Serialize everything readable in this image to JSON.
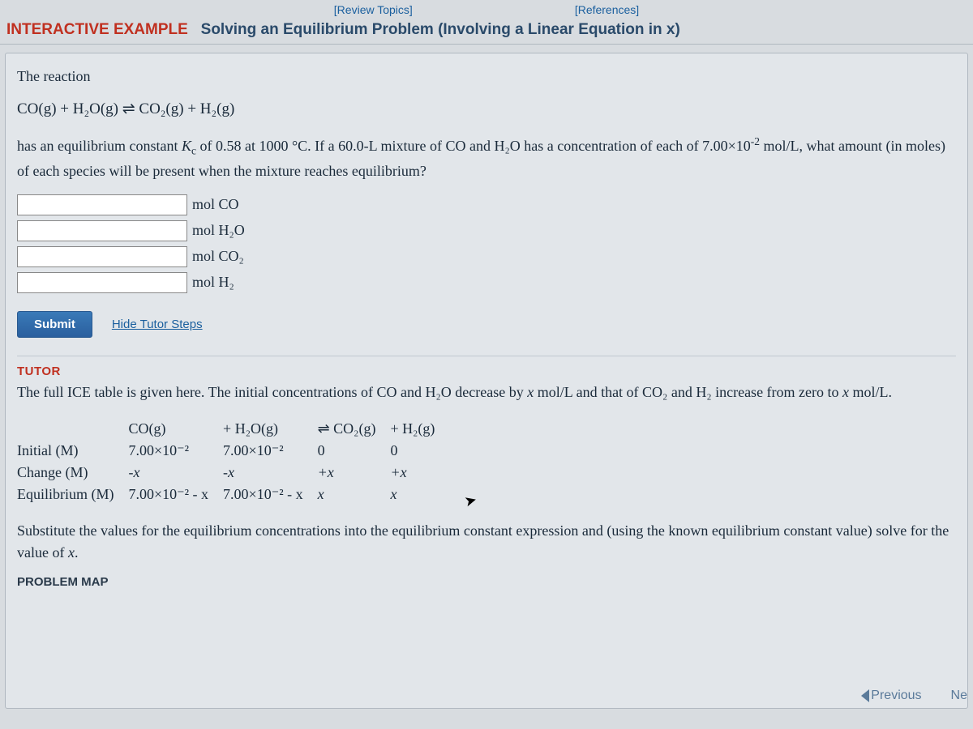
{
  "topLinks": {
    "review": "[Review Topics]",
    "references": "[References]"
  },
  "title": {
    "prefix": "INTERACTIVE EXAMPLE",
    "main": "Solving an Equilibrium Problem (Involving a Linear Equation in x)"
  },
  "problem": {
    "intro": "The reaction",
    "equation": "CO(g) + H₂O(g) ⇌ CO₂(g) + H₂(g)",
    "body_a": "has an equilibrium constant ",
    "kc": "K",
    "kc_sub": "c",
    "body_b": " of 0.58 at 1000 °C. If a 60.0-L mixture of CO and H₂O has a concentration of each of 7.00×10",
    "exp": "-2",
    "body_c": " mol/L, what amount (in moles) of each species will be present when the mixture reaches equilibrium?"
  },
  "inputs": [
    {
      "value": "",
      "label": "mol CO"
    },
    {
      "value": "",
      "label": "mol H₂O"
    },
    {
      "value": "",
      "label": "mol CO₂"
    },
    {
      "value": "",
      "label": "mol H₂"
    }
  ],
  "actions": {
    "submit": "Submit",
    "hide": "Hide Tutor Steps"
  },
  "tutor": {
    "header": "TUTOR",
    "text_a": "The full ICE table is given here. The initial concentrations of CO and H₂O decrease by ",
    "x1": "x",
    "text_b": " mol/L and that of CO₂ and H₂ increase from zero to ",
    "x2": "x",
    "text_c": " mol/L.",
    "substitute": "Substitute the values for the equilibrium concentrations into the equilibrium constant expression and (using the known equilibrium constant value) solve for the value of ",
    "x3": "x",
    "period": "."
  },
  "ice": {
    "rowLabels": [
      "Initial (M)",
      "Change (M)",
      "Equilibrium (M)"
    ],
    "header": {
      "c1": "CO(g)",
      "c2": "+ H₂O(g)",
      "c3": "⇌ CO₂(g)",
      "c4": "+ H₂(g)"
    },
    "r1": {
      "c1": "7.00×10⁻²",
      "c2": "7.00×10⁻²",
      "c3": "0",
      "c4": "0"
    },
    "r2": {
      "c1": "-x",
      "c2": "-x",
      "c3": "+x",
      "c4": "+x"
    },
    "r3": {
      "c1": "7.00×10⁻² - x",
      "c2": "7.00×10⁻² - x",
      "c3": "x",
      "c4": "x"
    }
  },
  "problemMap": "PROBLEM MAP",
  "nav": {
    "previous": "Previous",
    "next": "Ne"
  },
  "chart_data": {
    "type": "table",
    "title": "ICE table for CO(g) + H2O(g) ⇌ CO2(g) + H2(g)",
    "columns": [
      "CO(g)",
      "H2O(g)",
      "CO2(g)",
      "H2(g)"
    ],
    "rows": [
      {
        "label": "Initial (M)",
        "values": [
          "7.00e-2",
          "7.00e-2",
          "0",
          "0"
        ]
      },
      {
        "label": "Change (M)",
        "values": [
          "-x",
          "-x",
          "+x",
          "+x"
        ]
      },
      {
        "label": "Equilibrium (M)",
        "values": [
          "7.00e-2 - x",
          "7.00e-2 - x",
          "x",
          "x"
        ]
      }
    ],
    "constants": {
      "Kc": 0.58,
      "T_C": 1000,
      "V_L": 60.0,
      "initial_conc_mol_per_L": 0.07
    }
  }
}
